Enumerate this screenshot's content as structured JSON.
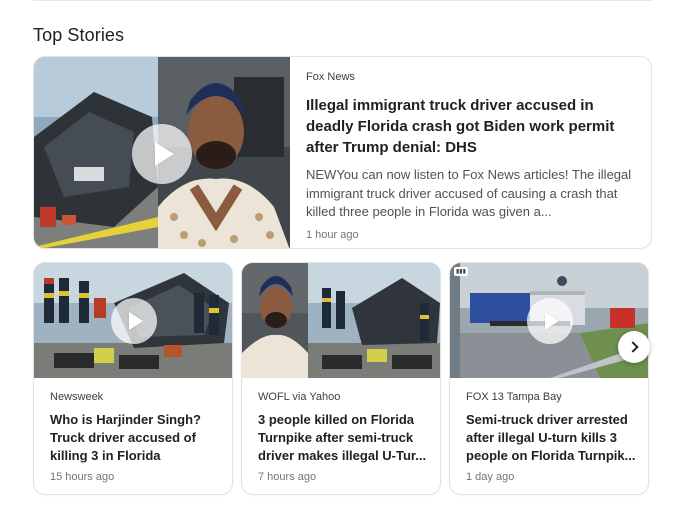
{
  "section": {
    "title": "Top Stories"
  },
  "main_story": {
    "source": "Fox News",
    "headline": "Illegal immigrant truck driver accused in deadly Florida crash got Biden work permit after Trump denial: DHS",
    "snippet": "NEWYou can now listen to Fox News articles! The illegal immigrant truck driver accused of causing a crash that killed three people in Florida was given a...",
    "time": "1 hour ago",
    "has_video": true
  },
  "stories": [
    {
      "source": "Newsweek",
      "headline": "Who is Harjinder Singh? Truck driver accused of killing 3 in Florida",
      "time": "15 hours ago",
      "has_video": true
    },
    {
      "source": "WOFL via Yahoo",
      "headline": "3 people killed on Florida Turnpike after semi-truck driver makes illegal U-Tur...",
      "time": "7 hours ago",
      "has_video": false
    },
    {
      "source": "FOX 13 Tampa Bay",
      "headline": "Semi-truck driver arrested after illegal U-turn kills 3 people on Florida Turnpik...",
      "time": "1 day ago",
      "has_video": true
    }
  ],
  "icons": {
    "play": "play-icon",
    "next": "chevron-right-icon"
  },
  "colors": {
    "headline": "#202124",
    "snippet": "#4d5156",
    "meta": "#70757a"
  }
}
